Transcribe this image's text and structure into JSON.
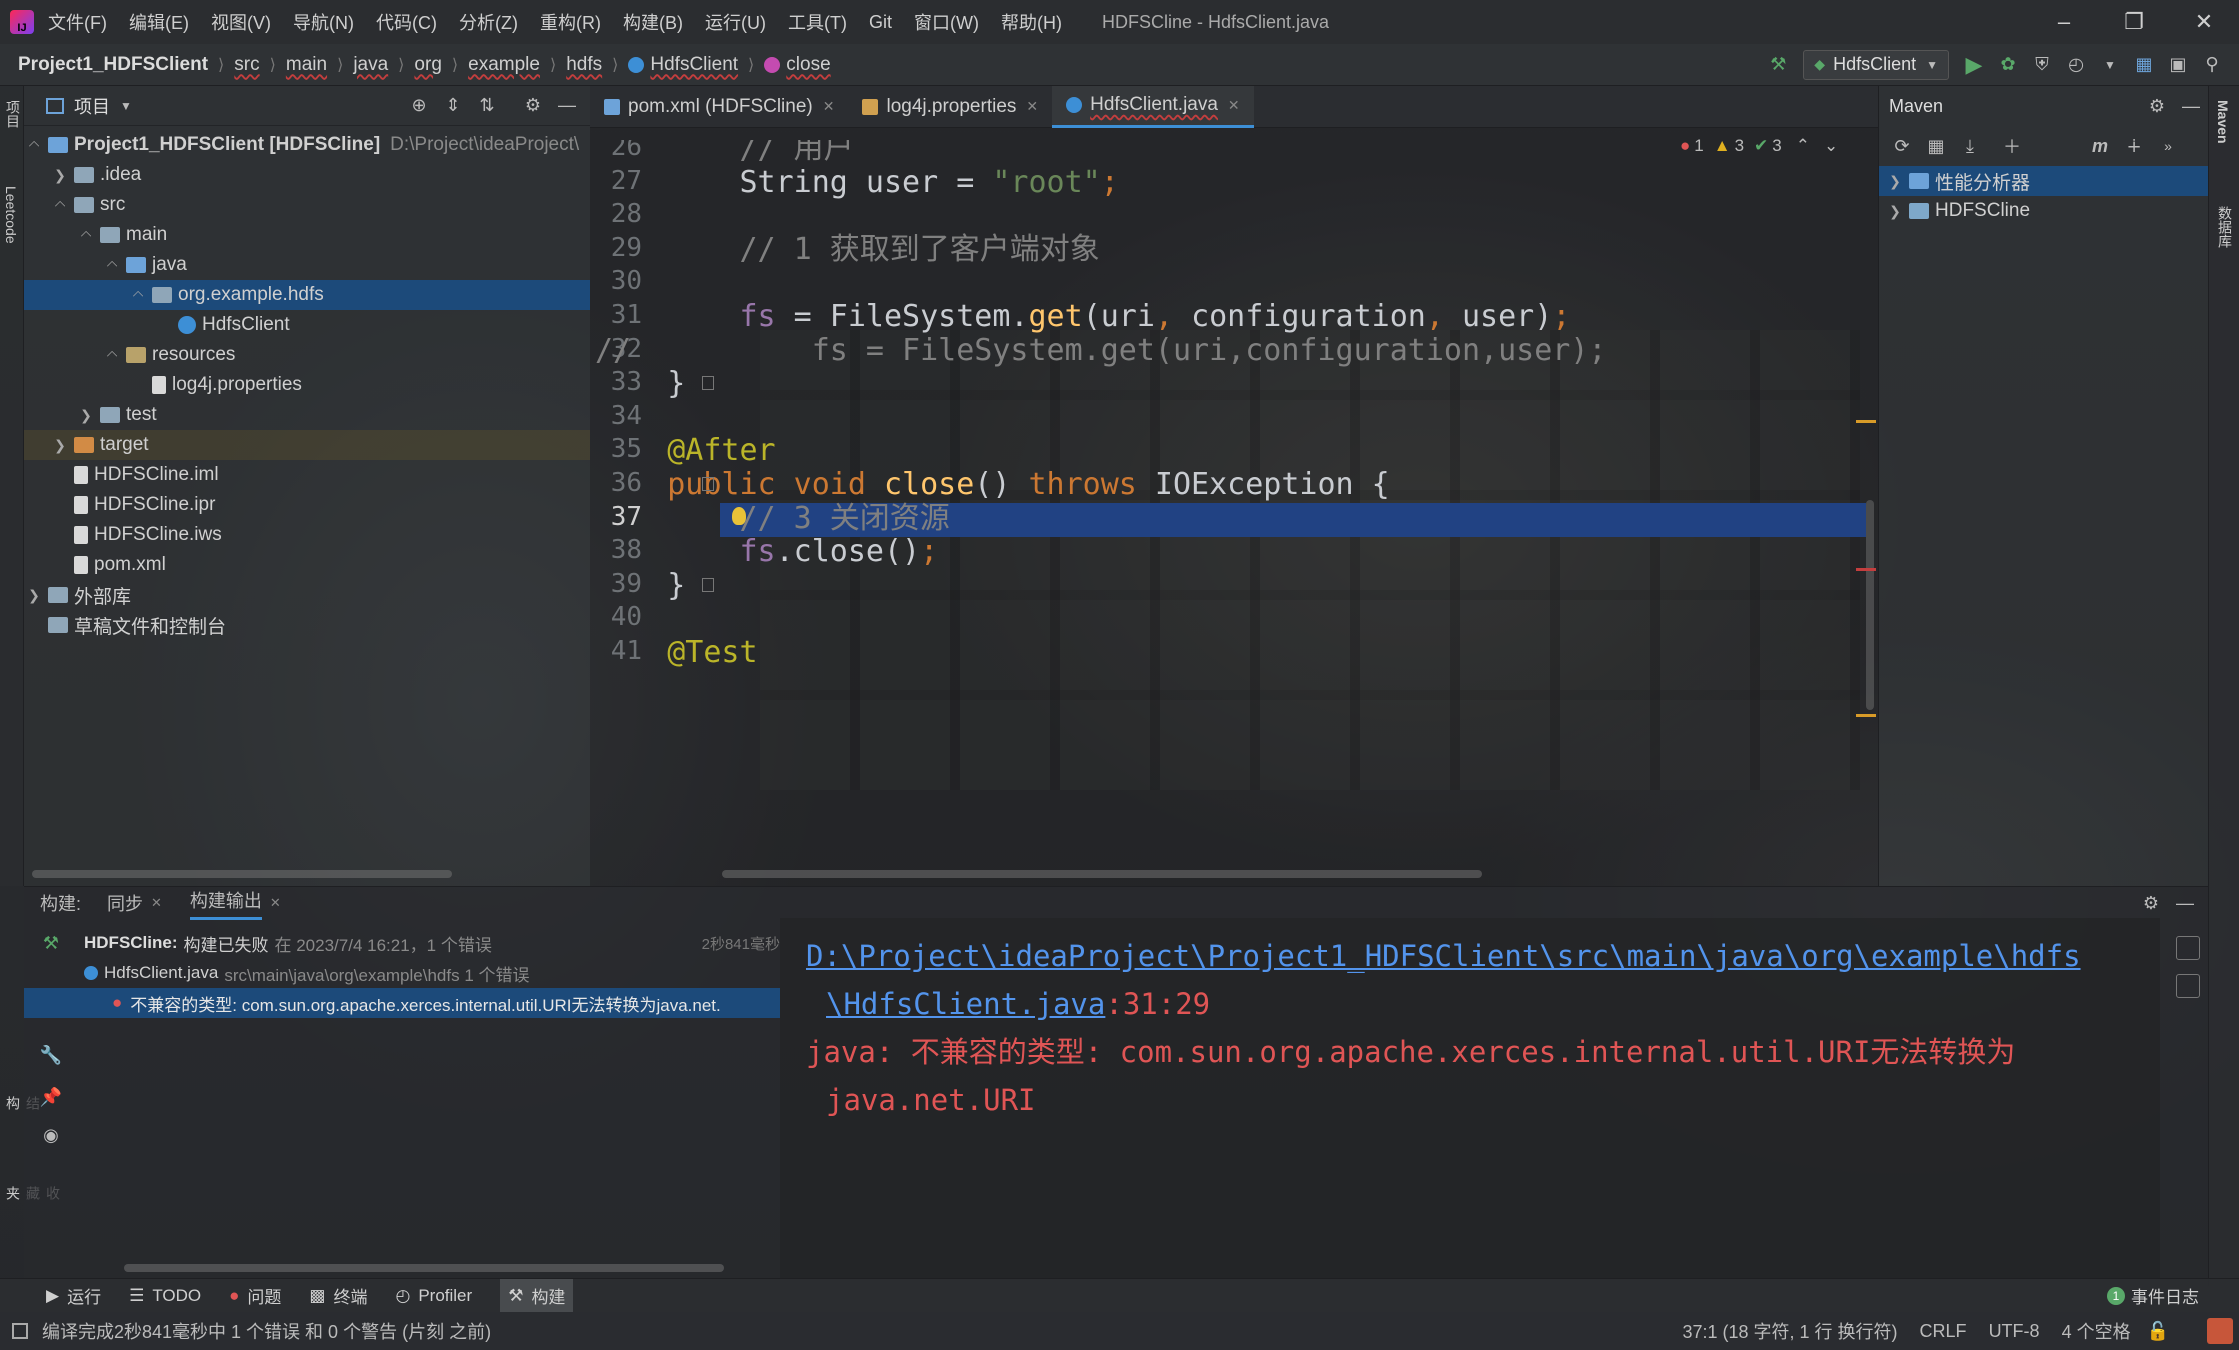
{
  "app": {
    "logo": "IJ",
    "window_title": "HDFSCline - HdfsClient.java"
  },
  "menu": [
    "文件(F)",
    "编辑(E)",
    "视图(V)",
    "导航(N)",
    "代码(C)",
    "分析(Z)",
    "重构(R)",
    "构建(B)",
    "运行(U)",
    "工具(T)",
    "Git",
    "窗口(W)",
    "帮助(H)"
  ],
  "breadcrumb": {
    "project": "Project1_HDFSClient",
    "items": [
      "src",
      "main",
      "java",
      "org",
      "example",
      "hdfs",
      "HdfsClient",
      "close"
    ]
  },
  "run_config": "HdfsClient",
  "project_panel": {
    "title": "项目",
    "tree": [
      {
        "label": "Project1_HDFSClient [HDFSCline]",
        "path": "D:\\Project\\ideaProject\\",
        "level": 0,
        "expanded": true,
        "icon": "module"
      },
      {
        "label": ".idea",
        "level": 1,
        "expanded": false,
        "icon": "folder"
      },
      {
        "label": "src",
        "level": 1,
        "expanded": true,
        "icon": "folder"
      },
      {
        "label": "main",
        "level": 2,
        "expanded": true,
        "icon": "folder"
      },
      {
        "label": "java",
        "level": 3,
        "expanded": true,
        "icon": "folder-src"
      },
      {
        "label": "org.example.hdfs",
        "level": 4,
        "expanded": true,
        "icon": "package",
        "selected": true
      },
      {
        "label": "HdfsClient",
        "level": 5,
        "icon": "java-class"
      },
      {
        "label": "resources",
        "level": 3,
        "expanded": true,
        "icon": "folder-res"
      },
      {
        "label": "log4j.properties",
        "level": 4,
        "icon": "properties"
      },
      {
        "label": "test",
        "level": 2,
        "expanded": false,
        "icon": "folder"
      },
      {
        "label": "target",
        "level": 1,
        "expanded": false,
        "icon": "folder-excluded",
        "highlight": true
      },
      {
        "label": "HDFSCline.iml",
        "level": 1,
        "icon": "file"
      },
      {
        "label": "HDFSCline.ipr",
        "level": 1,
        "icon": "file"
      },
      {
        "label": "HDFSCline.iws",
        "level": 1,
        "icon": "file"
      },
      {
        "label": "pom.xml",
        "level": 1,
        "icon": "maven"
      },
      {
        "label": "外部库",
        "level": 0,
        "expanded": false,
        "icon": "library"
      },
      {
        "label": "草稿文件和控制台",
        "level": 0,
        "icon": "scratch"
      }
    ]
  },
  "editor": {
    "tabs": [
      {
        "label": "pom.xml (HDFSCline)",
        "icon": "m"
      },
      {
        "label": "log4j.properties",
        "icon": "props"
      },
      {
        "label": "HdfsClient.java",
        "icon": "class",
        "active": true
      }
    ],
    "inspections": {
      "errors": "1",
      "warnings": "3",
      "ok": "3"
    },
    "lines": [
      {
        "num": "26",
        "tokens": [
          [
            "cm",
            "        // 用户"
          ]
        ]
      },
      {
        "num": "27",
        "tokens": [
          [
            "",
            "        String user = "
          ],
          [
            "str",
            "\"root\""
          ],
          [
            "kw",
            ";"
          ]
        ]
      },
      {
        "num": "28",
        "tokens": []
      },
      {
        "num": "29",
        "tokens": [
          [
            "cm",
            "        // 1 获取到了客户端对象"
          ]
        ]
      },
      {
        "num": "30",
        "tokens": []
      },
      {
        "num": "31",
        "tokens": [
          [
            "fld",
            "        fs"
          ],
          [
            "",
            " = FileSystem."
          ],
          [
            "fn",
            "get"
          ],
          [
            "",
            "(uri"
          ],
          [
            "kw",
            ", "
          ],
          [
            "",
            "configuration"
          ],
          [
            "kw",
            ", "
          ],
          [
            "",
            "user)"
          ],
          [
            "kw",
            ";"
          ]
        ]
      },
      {
        "num": "32",
        "tokens": [
          [
            "cm",
            "//          fs = FileSystem.get(uri,configuration,user);"
          ]
        ]
      },
      {
        "num": "33",
        "tokens": [
          [
            "",
            "    }"
          ]
        ]
      },
      {
        "num": "34",
        "tokens": []
      },
      {
        "num": "35",
        "tokens": [
          [
            "ann",
            "    @After"
          ]
        ]
      },
      {
        "num": "36",
        "tokens": [
          [
            "kw",
            "    public void "
          ],
          [
            "fn",
            "close"
          ],
          [
            "",
            "() "
          ],
          [
            "kw",
            "throws "
          ],
          [
            "",
            "IOException {"
          ]
        ]
      },
      {
        "num": "37",
        "tokens": [
          [
            "cm",
            "        // 3 关闭资源"
          ]
        ],
        "current": true
      },
      {
        "num": "38",
        "tokens": [
          [
            "fld",
            "        fs"
          ],
          [
            "",
            ".close()"
          ],
          [
            "kw",
            ";"
          ]
        ]
      },
      {
        "num": "39",
        "tokens": [
          [
            "",
            "    }"
          ]
        ]
      },
      {
        "num": "40",
        "tokens": []
      },
      {
        "num": "41",
        "tokens": [
          [
            "ann",
            "    @Test"
          ]
        ]
      }
    ]
  },
  "maven": {
    "title": "Maven",
    "items": [
      "性能分析器",
      "HDFSCline"
    ]
  },
  "build": {
    "tabs": [
      "构建:",
      "同步",
      "构建输出"
    ],
    "result_title": "HDFSCline:",
    "result_text": "构建已失败",
    "result_meta": "在 2023/7/4 16:21，1 个错误",
    "duration": "2秒841毫秒",
    "file": "HdfsClient.java",
    "file_path": "src\\main\\java\\org\\example\\hdfs 1 个错误",
    "error": "不兼容的类型: com.sun.org.apache.xerces.internal.util.URI无法转换为java.net.",
    "output_link1": "D:\\Project\\ideaProject\\Project1_HDFSClient\\src\\main\\java\\org\\example\\hdfs",
    "output_link2": "\\HdfsClient.java",
    "output_pos": ":31:29",
    "output_err1": "java: 不兼容的类型: com.sun.org.apache.xerces.internal.util.URI无法转换为",
    "output_err2": "java.net.URI"
  },
  "bottom_tabs": [
    "运行",
    "TODO",
    "问题",
    "终端",
    "Profiler",
    "构建"
  ],
  "event_log": {
    "count": "1",
    "label": "事件日志"
  },
  "status": {
    "message": "编译完成2秒841毫秒中 1 个错误 和 0 个警告 (片刻 之前)",
    "position": "37:1 (18 字符, 1 行 换行符)",
    "line_sep": "CRLF",
    "encoding": "UTF-8",
    "indent": "4 个空格"
  },
  "side_labels": {
    "left": [
      "项目",
      "Leetcode",
      "结构",
      "收藏夹"
    ],
    "right": [
      "Maven",
      "数据库"
    ]
  },
  "colors": {
    "accent": "#3d8fd6",
    "error": "#e05555",
    "link": "#5394ec",
    "selection": "#214283"
  }
}
